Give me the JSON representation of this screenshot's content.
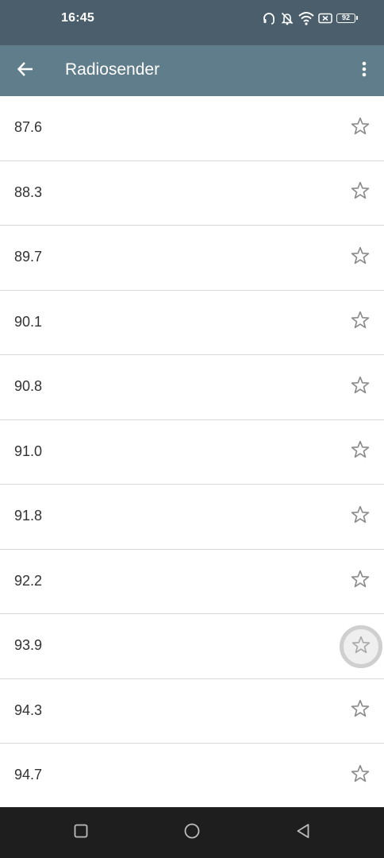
{
  "status_bar": {
    "time": "16:45",
    "battery_level": "92",
    "icons": [
      "headset-icon",
      "notifications-off-icon",
      "wifi-icon",
      "sim-off-icon",
      "battery-icon"
    ]
  },
  "app_bar": {
    "title": "Radiosender",
    "back_icon": "arrow-back-icon",
    "menu_icon": "more-vert-icon"
  },
  "stations": [
    {
      "frequency": "87.6",
      "favorite": false
    },
    {
      "frequency": "88.3",
      "favorite": false
    },
    {
      "frequency": "89.7",
      "favorite": false
    },
    {
      "frequency": "90.1",
      "favorite": false
    },
    {
      "frequency": "90.8",
      "favorite": false
    },
    {
      "frequency": "91.0",
      "favorite": false
    },
    {
      "frequency": "91.8",
      "favorite": false
    },
    {
      "frequency": "92.2",
      "favorite": false
    },
    {
      "frequency": "93.9",
      "favorite": false,
      "pressed": true
    },
    {
      "frequency": "94.3",
      "favorite": false
    },
    {
      "frequency": "94.7",
      "favorite": false
    }
  ],
  "nav_bar": {
    "buttons": [
      "recents-square-icon",
      "home-circle-icon",
      "back-triangle-icon"
    ]
  },
  "colors": {
    "status_bar": "#4a5f6b",
    "app_bar": "#607d8b",
    "nav_bar": "#1e1e1e",
    "star_outline": "#8a8a8a"
  }
}
